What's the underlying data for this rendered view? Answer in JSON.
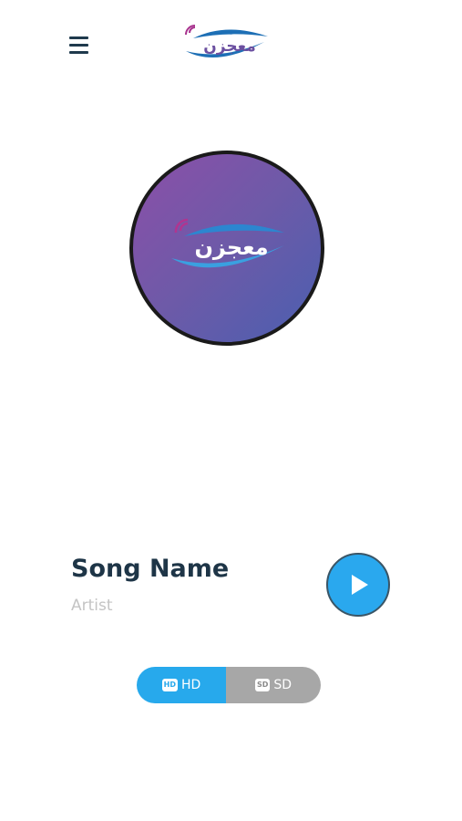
{
  "header": {
    "logo_text": "معجزن",
    "menu_icon": "hamburger-menu-icon"
  },
  "now_playing": {
    "artwork_logo_text": "معجزن",
    "song_name": "Song Name",
    "artist": "Artist",
    "play_icon": "play-icon"
  },
  "quality": {
    "hd_badge": "HD",
    "hd_label": "HD",
    "sd_badge": "SD",
    "sd_label": "SD",
    "selected": "HD"
  },
  "colors": {
    "accent": "#27a9ec",
    "title": "#1e3547",
    "artist": "#c4c4c4",
    "toggle_inactive": "#a7a7a7",
    "artwork_gradient_start": "#8c4fa8",
    "artwork_gradient_end": "#4a5fb0"
  }
}
